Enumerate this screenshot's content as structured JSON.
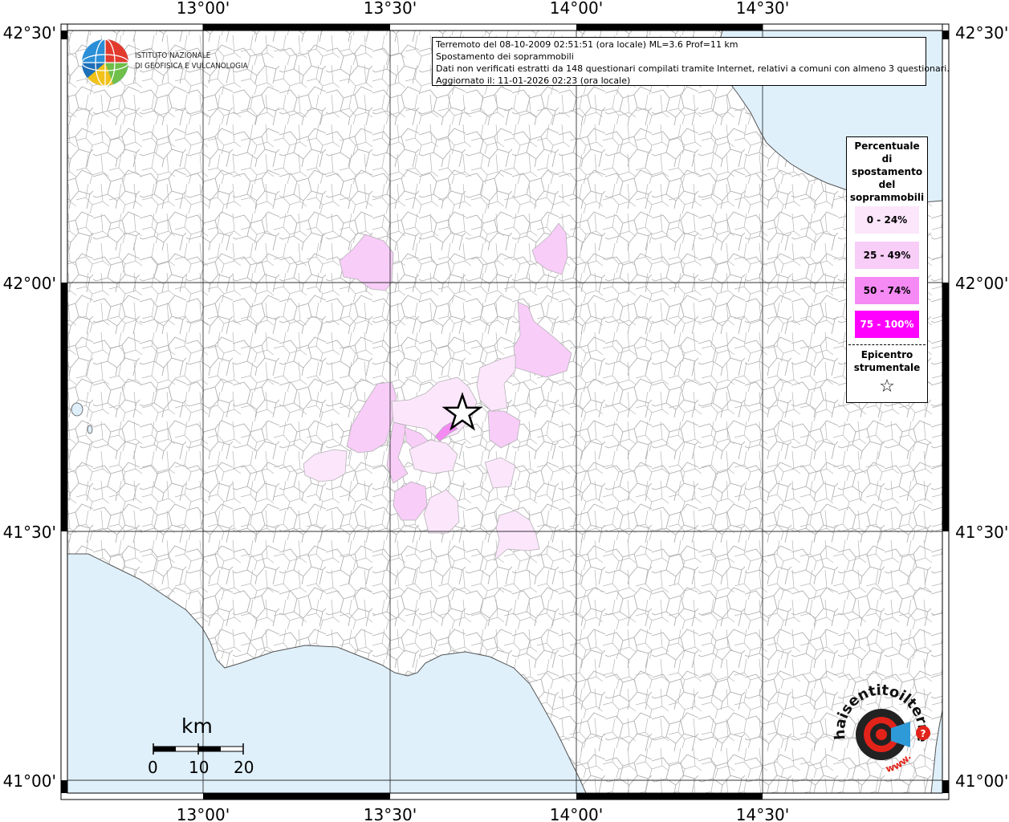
{
  "map": {
    "lon_labels": [
      "13°00'",
      "13°30'",
      "14°00'",
      "14°30'"
    ],
    "lat_labels": [
      "42°30'",
      "42°00'",
      "41°30'",
      "41°00'"
    ],
    "colors": {
      "sea": "#dff0fb",
      "land": "#ffffff",
      "borders": "#a8a8a8",
      "class_0_24": "#fce6fc",
      "class_25_49": "#f8cdf8",
      "class_50_74": "#f58af5",
      "class_75_100": "#ff00ff"
    }
  },
  "info": {
    "line1": "Terremoto del 08-10-2009 02:51:51 (ora locale) ML=3.6 Prof=11 km",
    "line2": "Spostamento dei soprammobili",
    "line3": "Dati non verificati estratti da 148 questionari compilati tramite Internet, relativi a comuni con almeno 3 questionari.",
    "line4": "Aggiornato il: 11-01-2026 02:23 (ora locale)"
  },
  "legend": {
    "title_lines": [
      "Percentuale",
      "di",
      "spostamento",
      "del",
      "soprammobili"
    ],
    "classes": [
      "0 - 24%",
      "25 - 49%",
      "50 - 74%",
      "75 - 100%"
    ],
    "epicenter_lines": [
      "Epicentro",
      "strumentale"
    ],
    "epicenter_symbol": "☆"
  },
  "logo": {
    "line1": "ISTITUTO NAZIONALE",
    "line2": "DI GEOFISICA E VULCANOLOGIA"
  },
  "scale": {
    "unit": "km",
    "ticks": [
      "0",
      "10",
      "20"
    ]
  },
  "hst_logo": {
    "text_top": "haisentitoilterremoto.it",
    "text_bottom": "www."
  }
}
